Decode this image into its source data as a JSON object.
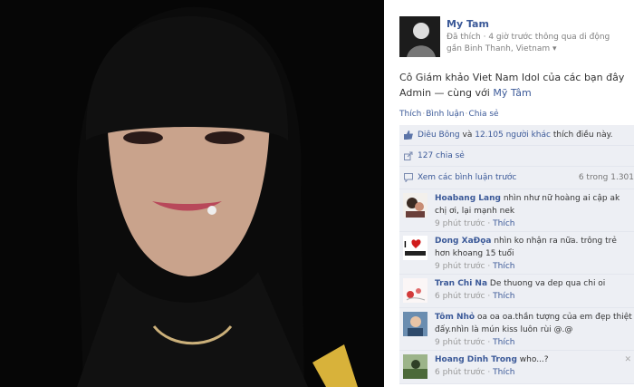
{
  "post": {
    "author": "My Tam",
    "meta": "Đã thích · 4 giờ trước thông qua di động gần Binh Thanh, Vietnam ▾",
    "caption_text": "Cô Giám khảo Viet Nam Idol của các bạn đây Admin — cùng với",
    "caption_link": "Mỹ Tâm",
    "actions": {
      "like": "Thích",
      "comment": "Bình luận",
      "share": "Chia sẻ"
    }
  },
  "ufi": {
    "likes_names": "Diêu Bông",
    "likes_mid": "và",
    "likes_count": "12.105 người khác",
    "likes_tail": "thích điều này.",
    "shares": "127 chia sẻ",
    "view_previous": "Xem các bình luận trước",
    "comment_count": "6 trong 1.301"
  },
  "comments": [
    {
      "name": "Hoabang Lang",
      "text": "nhìn như nữ hoàng ai cập ak chị ơi, lại mạnh nek",
      "time": "9 phút trước",
      "like": "Thích"
    },
    {
      "name": "Dong XaĐọa",
      "text": "nhìn ko nhận ra nữa. trông trẻ hơn khoang 15 tuổi",
      "time": "9 phút trước",
      "like": "Thích"
    },
    {
      "name": "Tran Chi Na",
      "text": "De thuong va dep qua chi oi",
      "time": "6 phút trước",
      "like": "Thích"
    },
    {
      "name": "Tôm Nhỏ",
      "text": "oa oa oa.thần tượng của em đẹp thiệt đấy.nhìn là mún kiss luôn rùi @.@",
      "time": "9 phút trước",
      "like": "Thích"
    },
    {
      "name": "Hoang Dinh Trong",
      "text": "who...?",
      "time": "6 phút trước",
      "like": "Thích"
    }
  ]
}
